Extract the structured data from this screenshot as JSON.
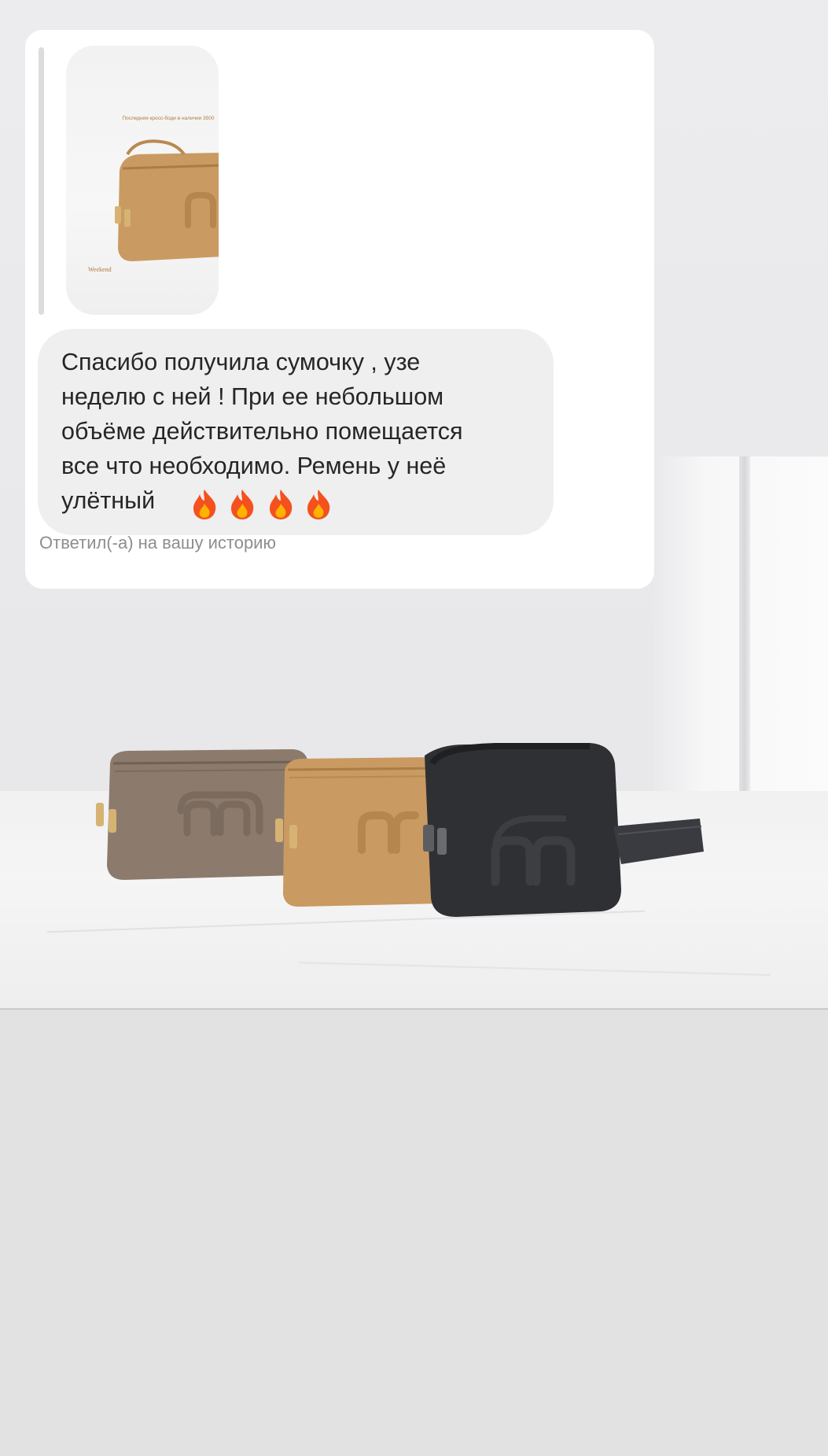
{
  "story": {
    "background_photo": "three crossbody bags (taupe, camel, black) on a marble counter"
  },
  "reply_card": {
    "thumbnail": {
      "caption": "Последняя кросс-боди в наличии 3500",
      "brand": "Weekend"
    },
    "message": {
      "text": "Спасибо получила сумочку , узе\nнеделю с ней ! При ее небольшом\nобъёме действительно помещается\nвсе что необходимо.  Ремень у неё\nулётный",
      "emoji": [
        "fire-icon",
        "fire-icon",
        "fire-icon",
        "fire-icon"
      ]
    },
    "status": "Ответил(-а) на вашу историю"
  },
  "colors": {
    "card_bg": "#ffffff",
    "bubble_bg": "#efefef",
    "text": "#262626",
    "muted_text": "#8e8e8e",
    "bag_taupe": "#8c7b6c",
    "bag_camel": "#c99a62",
    "bag_black": "#2f3033"
  }
}
